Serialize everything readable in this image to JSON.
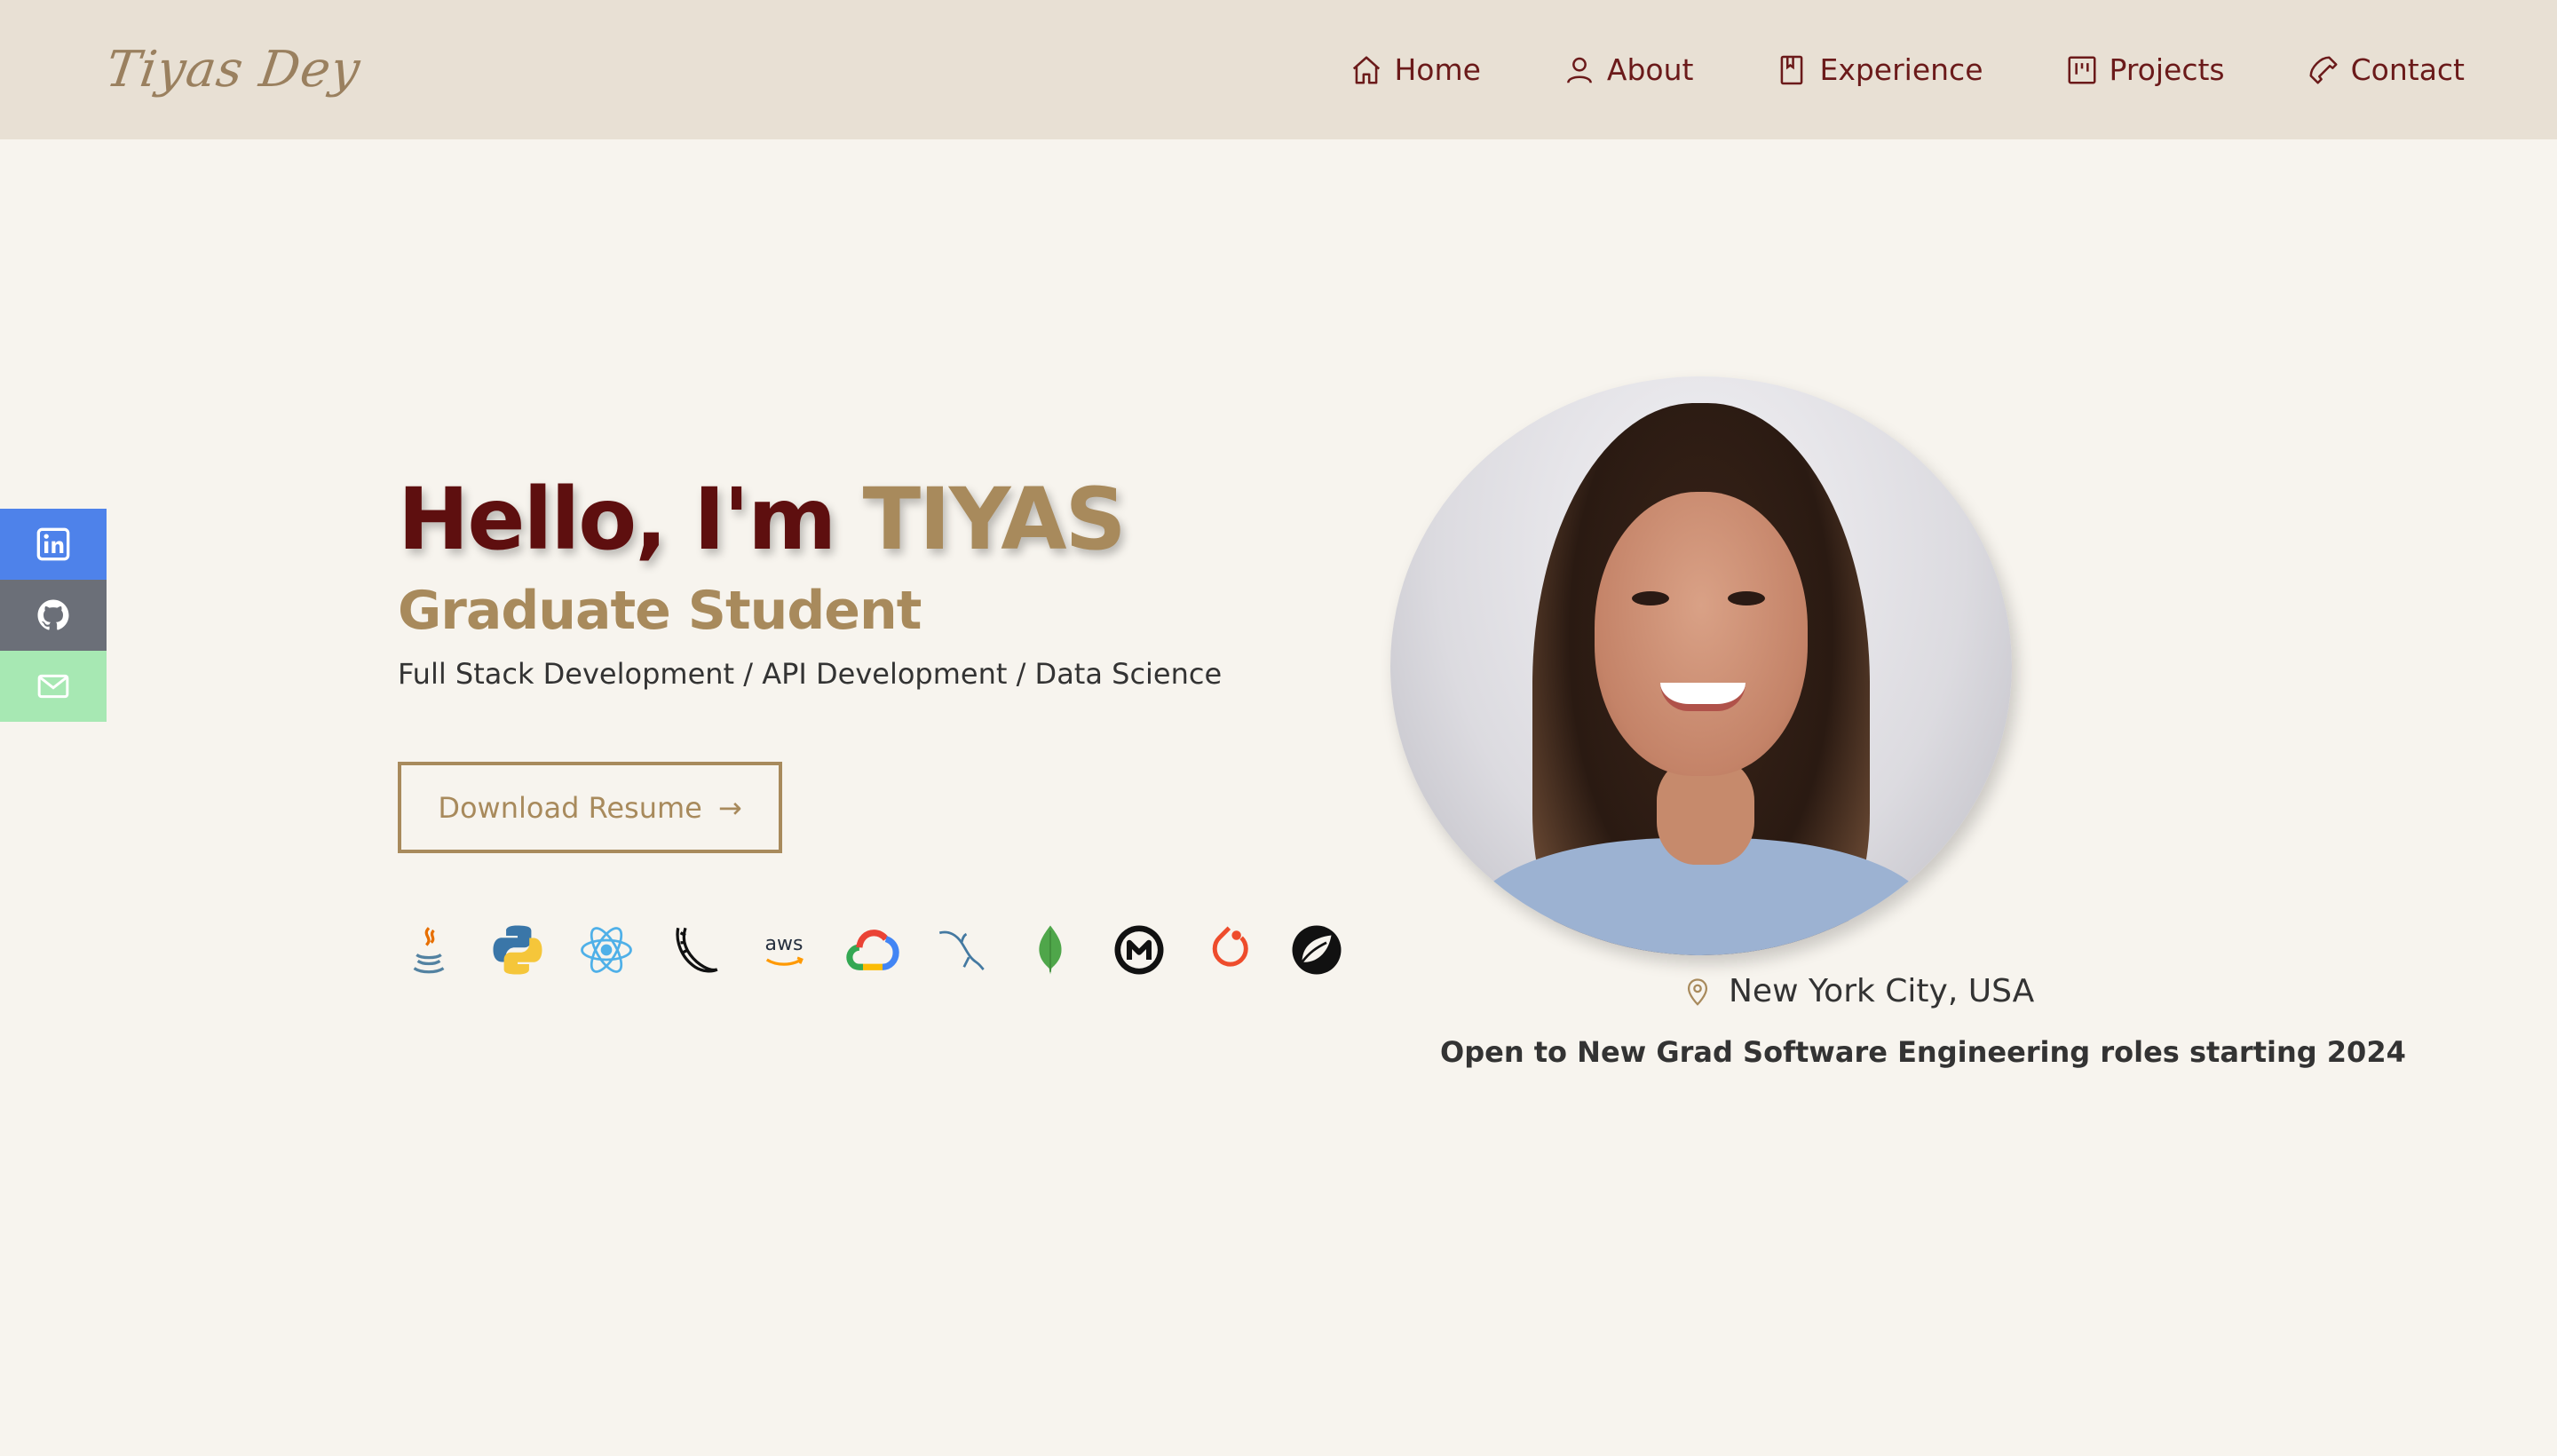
{
  "header": {
    "logo": "Tiyas Dey",
    "nav": [
      {
        "label": "Home",
        "icon": "home-icon"
      },
      {
        "label": "About",
        "icon": "user-icon"
      },
      {
        "label": "Experience",
        "icon": "bookmark-icon"
      },
      {
        "label": "Projects",
        "icon": "kanban-icon"
      },
      {
        "label": "Contact",
        "icon": "phone-icon"
      }
    ]
  },
  "social": [
    {
      "name": "LinkedIn",
      "icon": "linkedin-icon",
      "color": "#4e82ea"
    },
    {
      "name": "GitHub",
      "icon": "github-icon",
      "color": "#6b6f78"
    },
    {
      "name": "Email",
      "icon": "mail-icon",
      "color": "#a7e8b3"
    }
  ],
  "hero": {
    "greeting_prefix": "Hello, I'm ",
    "name": "TIYAS",
    "role": "Graduate Student",
    "skills": "Full Stack Development / API Development / Data Science",
    "resume_button": "Download Resume",
    "resume_arrow": "→",
    "tech_icons": [
      "java-icon",
      "python-icon",
      "react-icon",
      "flask-icon",
      "aws-icon",
      "google-cloud-icon",
      "mysql-icon",
      "mongodb-icon",
      "mulesoft-icon",
      "pytorch-icon",
      "spring-icon"
    ],
    "aws_text": "aws"
  },
  "profile": {
    "location": "New York City, USA",
    "open_to": "Open to New Grad Software Engineering roles starting 2024"
  },
  "colors": {
    "primary": "#5e0f0f",
    "accent": "#a88a5c",
    "header_bg": "#e8e0d4",
    "page_bg": "#f7f4ee"
  }
}
